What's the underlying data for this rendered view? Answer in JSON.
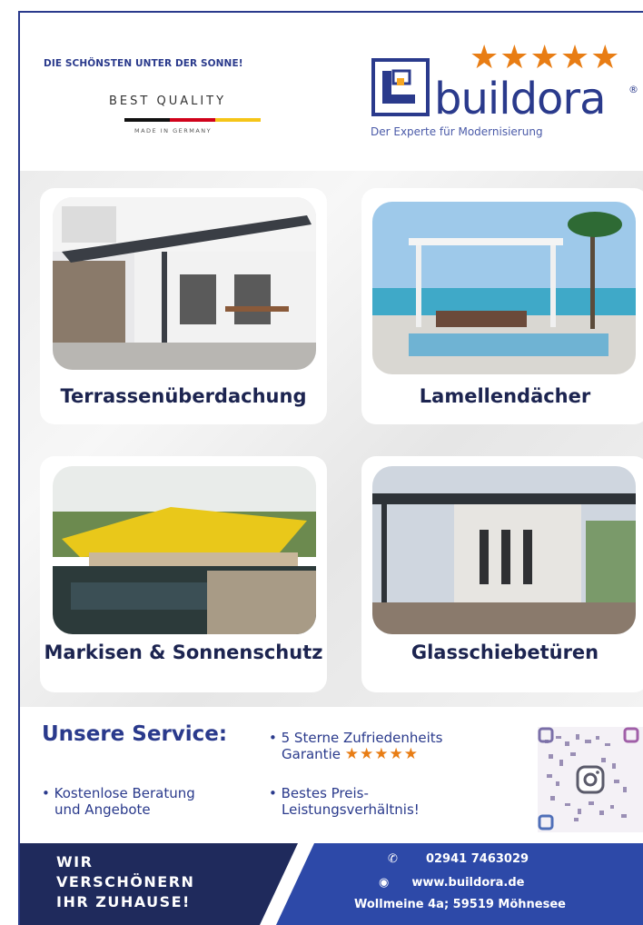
{
  "header": {
    "slogan": "DIE SCHÖNSTEN UNTER DER SONNE!",
    "best_quality": "BEST QUALITY",
    "made_in": "MADE IN GERMANY",
    "flag_colors": [
      "#111111",
      "#d0021b",
      "#f5c518"
    ],
    "brand_name": "buildora",
    "registered": "®",
    "tagline": "Der Experte für Modernisierung",
    "rating_stars": "★★★★★",
    "brand_color": "#2a3a8c",
    "star_color": "#e87d14"
  },
  "products": [
    {
      "label": "Terrassenüberdachung",
      "icon": "terrace-roof-photo"
    },
    {
      "label": "Lamellendächer",
      "icon": "louvered-roof-photo"
    },
    {
      "label": "Markisen & Sonnenschutz",
      "icon": "awning-photo"
    },
    {
      "label": "Glasschiebetüren",
      "icon": "glass-sliding-door-photo"
    }
  ],
  "service": {
    "title": "Unsere Service:",
    "items": [
      {
        "line1": "Kostenlose Beratung",
        "line2": "und Angebote"
      },
      {
        "line1": "5 Sterne Zufriedenheits",
        "line2": "Garantie",
        "stars": "★★★★★"
      },
      {
        "line1": "Bestes Preis-",
        "line2": "Leistungsverhältnis!"
      }
    ],
    "qr_icon": "instagram-qr-code"
  },
  "footer": {
    "slogan_lines": [
      "WIR",
      "VERSCHÖNERN",
      "IHR ZUHAUSE!"
    ],
    "phone": "02941 7463029",
    "website": "www.buildora.de",
    "address": "Wollmeine 4a; 59519 Möhnesee",
    "dark_color": "#1f2a5c",
    "light_color": "#2d49a8"
  }
}
